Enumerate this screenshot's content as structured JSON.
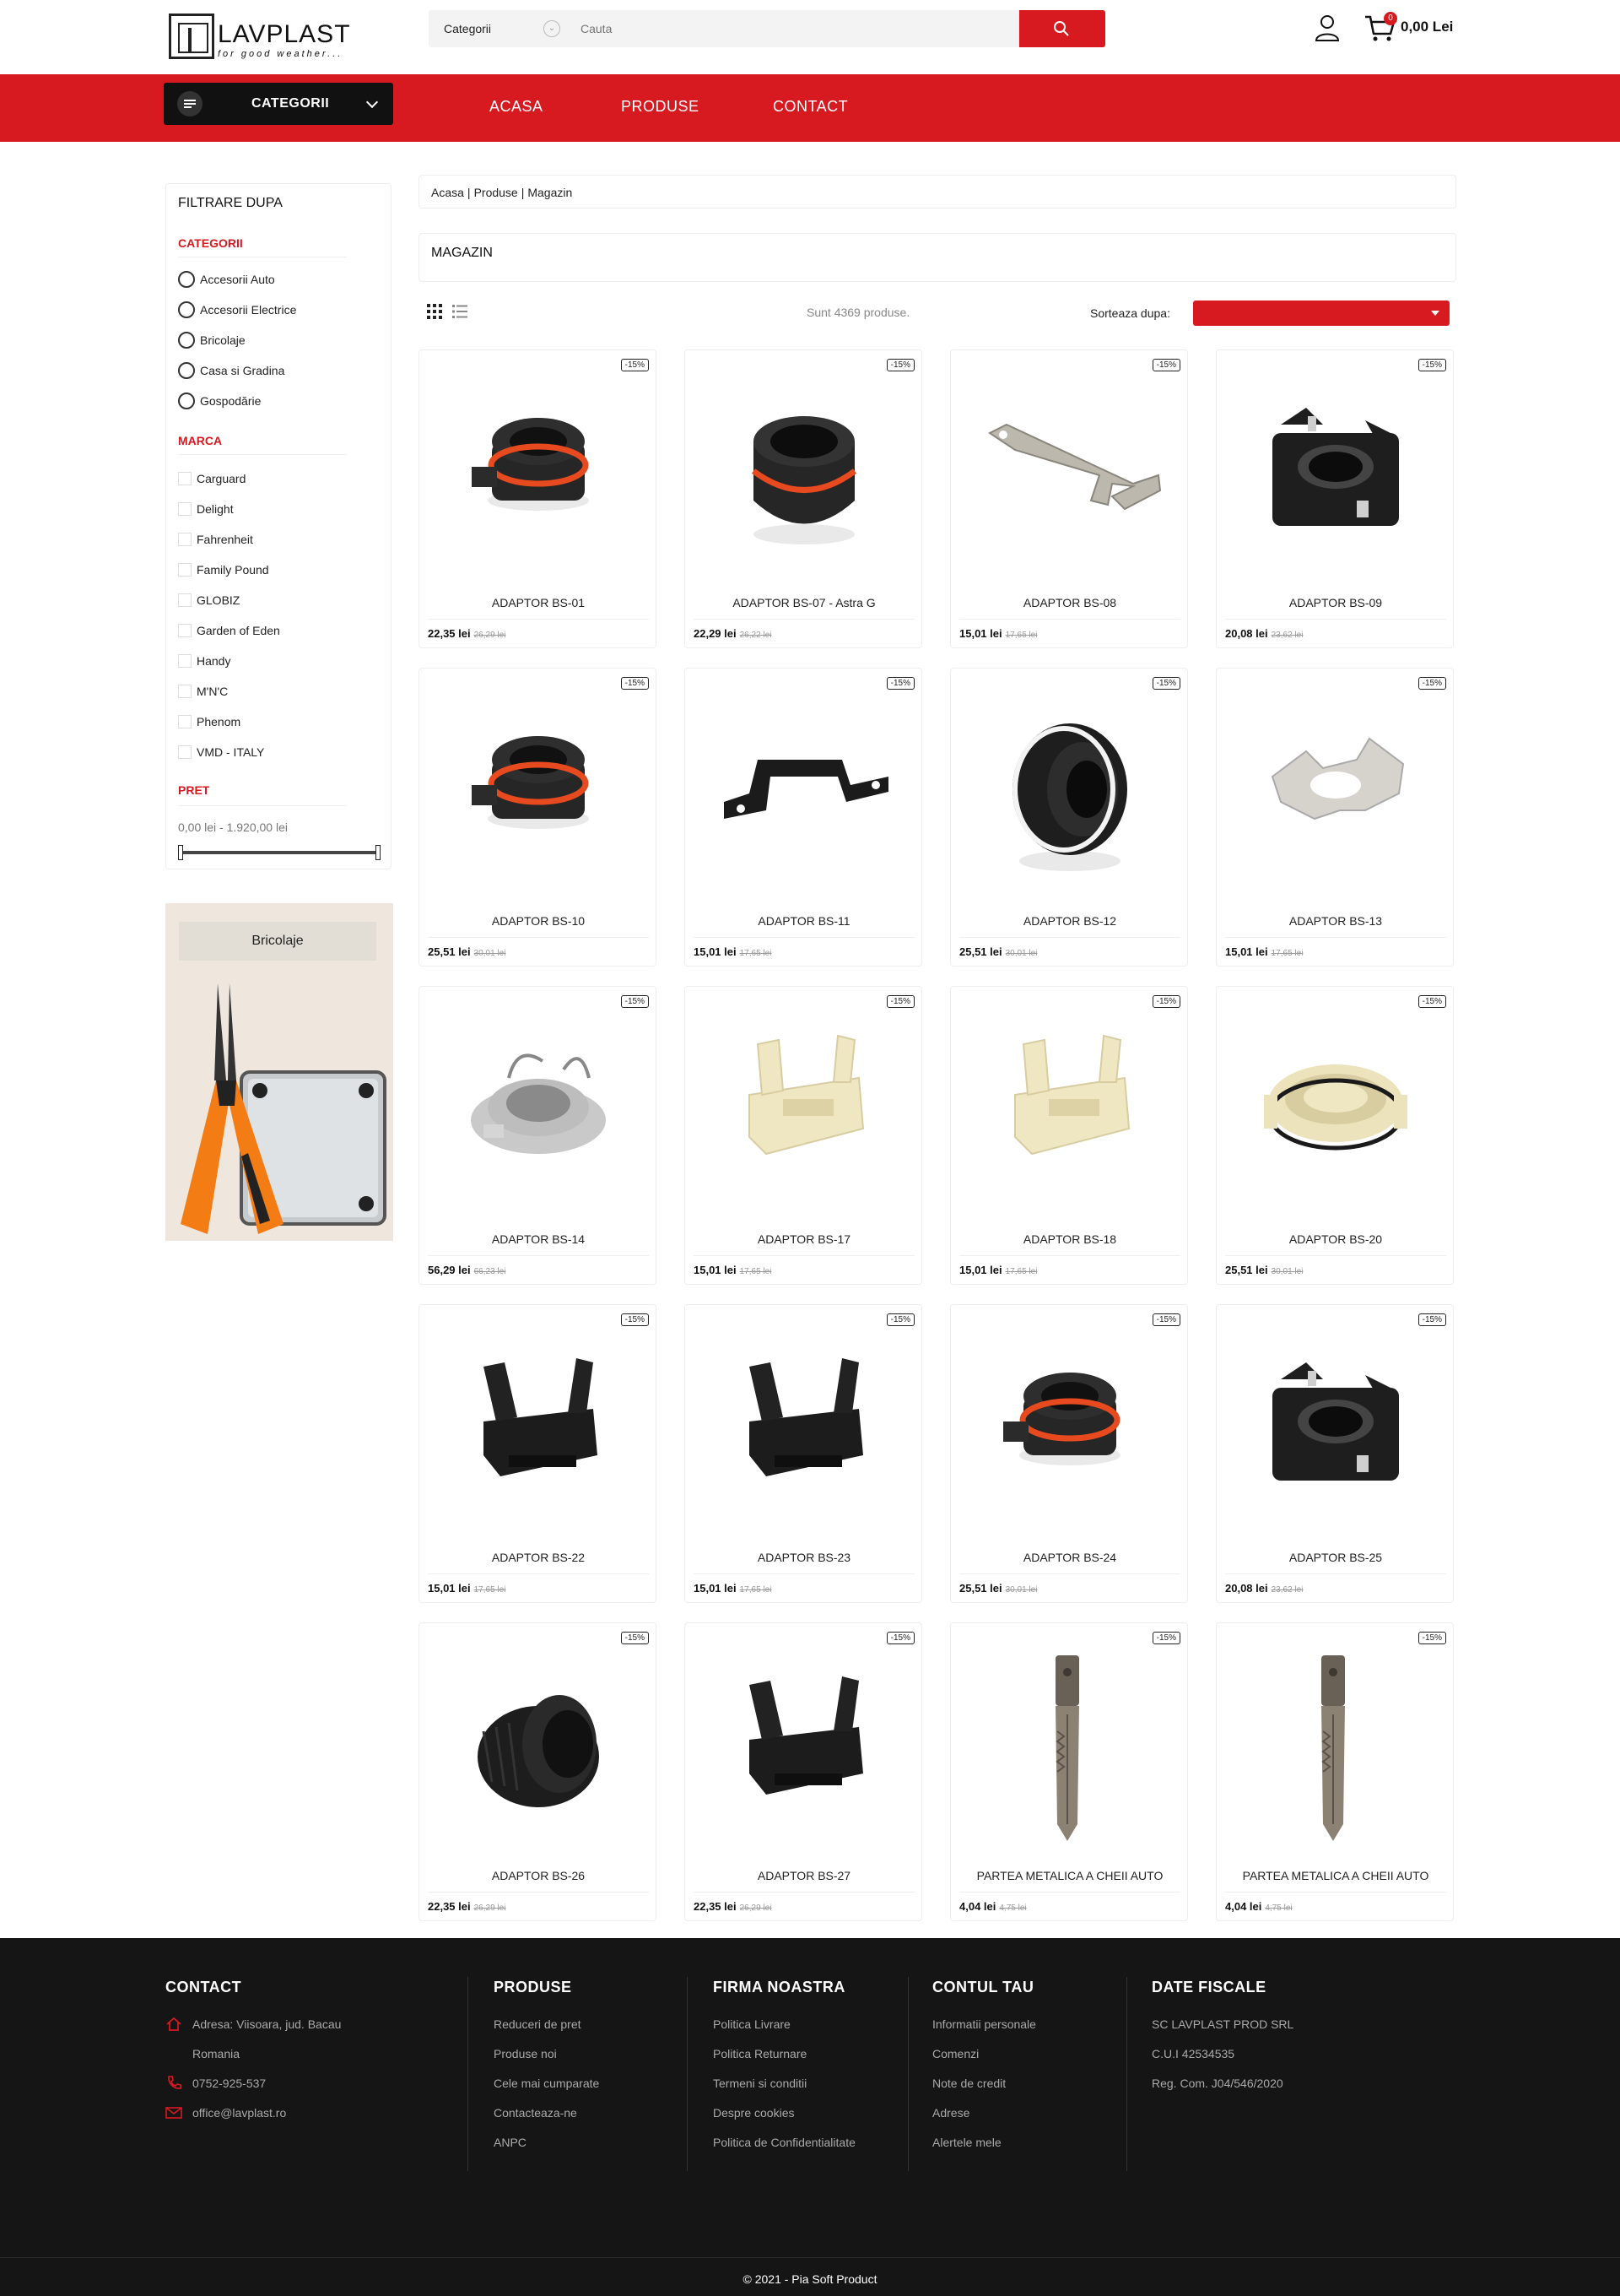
{
  "brand": {
    "name": "LAVPLAST",
    "tagline": "for good weather..."
  },
  "header": {
    "search_category": "Categorii",
    "search_placeholder": "Cauta",
    "cart_count": "0",
    "cart_total": "0,00 Lei"
  },
  "nav": {
    "categories_label": "CATEGORII",
    "links": [
      "ACASA",
      "PRODUSE",
      "CONTACT"
    ]
  },
  "sidebar": {
    "title": "FILTRARE DUPA",
    "categories_title": "CATEGORII",
    "categories": [
      "Accesorii Auto",
      "Accesorii Electrice",
      "Bricolaje",
      "Casa si Gradina",
      "Gospodărie"
    ],
    "brand_title": "MARCA",
    "brands": [
      "Carguard",
      "Delight",
      "Fahrenheit",
      "Family Pound",
      "GLOBIZ",
      "Garden of Eden",
      "Handy",
      "M'N'C",
      "Phenom",
      "VMD - ITALY"
    ],
    "price_title": "PRET",
    "price_range": "0,00 lei - 1.920,00 lei",
    "promo_title": "Bricolaje"
  },
  "main": {
    "breadcrumb": [
      "Acasa",
      "Produse",
      "Magazin"
    ],
    "page_title": "MAGAZIN",
    "count_text": "Sunt 4369 produse.",
    "sort_label": "Sorteaza dupa:",
    "products": [
      {
        "name": "ADAPTOR BS-01",
        "price": "22,35 lei",
        "old": "26,29 lei",
        "badge": "-15%",
        "shape": "ring-red"
      },
      {
        "name": "ADAPTOR BS-07 - Astra G",
        "price": "22,29 lei",
        "old": "26,22 lei",
        "badge": "-15%",
        "shape": "cup-red"
      },
      {
        "name": "ADAPTOR BS-08",
        "price": "15,01 lei",
        "old": "17,65 lei",
        "badge": "-15%",
        "shape": "metal-fork"
      },
      {
        "name": "ADAPTOR BS-09",
        "price": "20,08 lei",
        "old": "23,62 lei",
        "badge": "-15%",
        "shape": "black-mount"
      },
      {
        "name": "ADAPTOR BS-10",
        "price": "25,51 lei",
        "old": "30,01 lei",
        "badge": "-15%",
        "shape": "ring-red"
      },
      {
        "name": "ADAPTOR BS-11",
        "price": "15,01 lei",
        "old": "17,65 lei",
        "badge": "-15%",
        "shape": "black-bracket"
      },
      {
        "name": "ADAPTOR BS-12",
        "price": "25,51 lei",
        "old": "30,01 lei",
        "badge": "-15%",
        "shape": "ring-white"
      },
      {
        "name": "ADAPTOR BS-13",
        "price": "15,01 lei",
        "old": "17,65 lei",
        "badge": "-15%",
        "shape": "metal-plate"
      },
      {
        "name": "ADAPTOR BS-14",
        "price": "56,29 lei",
        "old": "66,23 lei",
        "badge": "-15%",
        "shape": "grey-socket"
      },
      {
        "name": "ADAPTOR BS-17",
        "price": "15,01 lei",
        "old": "17,65 lei",
        "badge": "-15%",
        "shape": "cream-clip"
      },
      {
        "name": "ADAPTOR BS-18",
        "price": "15,01 lei",
        "old": "17,65 lei",
        "badge": "-15%",
        "shape": "cream-clip"
      },
      {
        "name": "ADAPTOR BS-20",
        "price": "25,51 lei",
        "old": "30,01 lei",
        "badge": "-15%",
        "shape": "cream-ring"
      },
      {
        "name": "ADAPTOR BS-22",
        "price": "15,01 lei",
        "old": "17,65 lei",
        "badge": "-15%",
        "shape": "black-clip"
      },
      {
        "name": "ADAPTOR BS-23",
        "price": "15,01 lei",
        "old": "17,65 lei",
        "badge": "-15%",
        "shape": "black-clip"
      },
      {
        "name": "ADAPTOR BS-24",
        "price": "25,51 lei",
        "old": "30,01 lei",
        "badge": "-15%",
        "shape": "ring-red"
      },
      {
        "name": "ADAPTOR BS-25",
        "price": "20,08 lei",
        "old": "23,62 lei",
        "badge": "-15%",
        "shape": "black-mount"
      },
      {
        "name": "ADAPTOR BS-26",
        "price": "22,35 lei",
        "old": "26,29 lei",
        "badge": "-15%",
        "shape": "black-cylinder"
      },
      {
        "name": "ADAPTOR BS-27",
        "price": "22,35 lei",
        "old": "26,29 lei",
        "badge": "-15%",
        "shape": "black-clip"
      },
      {
        "name": "PARTEA METALICA A CHEII AUTO",
        "price": "4,04 lei",
        "old": "4,75 lei",
        "badge": "-15%",
        "shape": "key-blade"
      },
      {
        "name": "PARTEA METALICA A CHEII AUTO",
        "price": "4,04 lei",
        "old": "4,75 lei",
        "badge": "-15%",
        "shape": "key-blade"
      }
    ]
  },
  "footer": {
    "contact_title": "CONTACT",
    "contact": [
      "Adresa: Viisoara, jud. Bacau",
      "Romania",
      "0752-925-537",
      "office@lavplast.ro"
    ],
    "produse_title": "PRODUSE",
    "produse": [
      "Reduceri de pret",
      "Produse noi",
      "Cele mai cumparate",
      "Contacteaza-ne",
      "ANPC"
    ],
    "firma_title": "FIRMA NOASTRA",
    "firma": [
      "Politica Livrare",
      "Politica Returnare",
      "Termeni si conditii",
      "Despre cookies",
      "Politica de Confidentialitate"
    ],
    "cont_title": "CONTUL TAU",
    "cont": [
      "Informatii personale",
      "Comenzi",
      "Note de credit",
      "Adrese",
      "Alertele mele"
    ],
    "fiscal_title": "DATE FISCALE",
    "fiscal": [
      "SC LAVPLAST PROD SRL",
      "C.U.I 42534535",
      "Reg. Com. J04/546/2020"
    ],
    "copyright": "© 2021 - Pia Soft Product"
  },
  "colors": {
    "accent": "#d71920",
    "dark": "#111111",
    "footer": "#151515"
  }
}
